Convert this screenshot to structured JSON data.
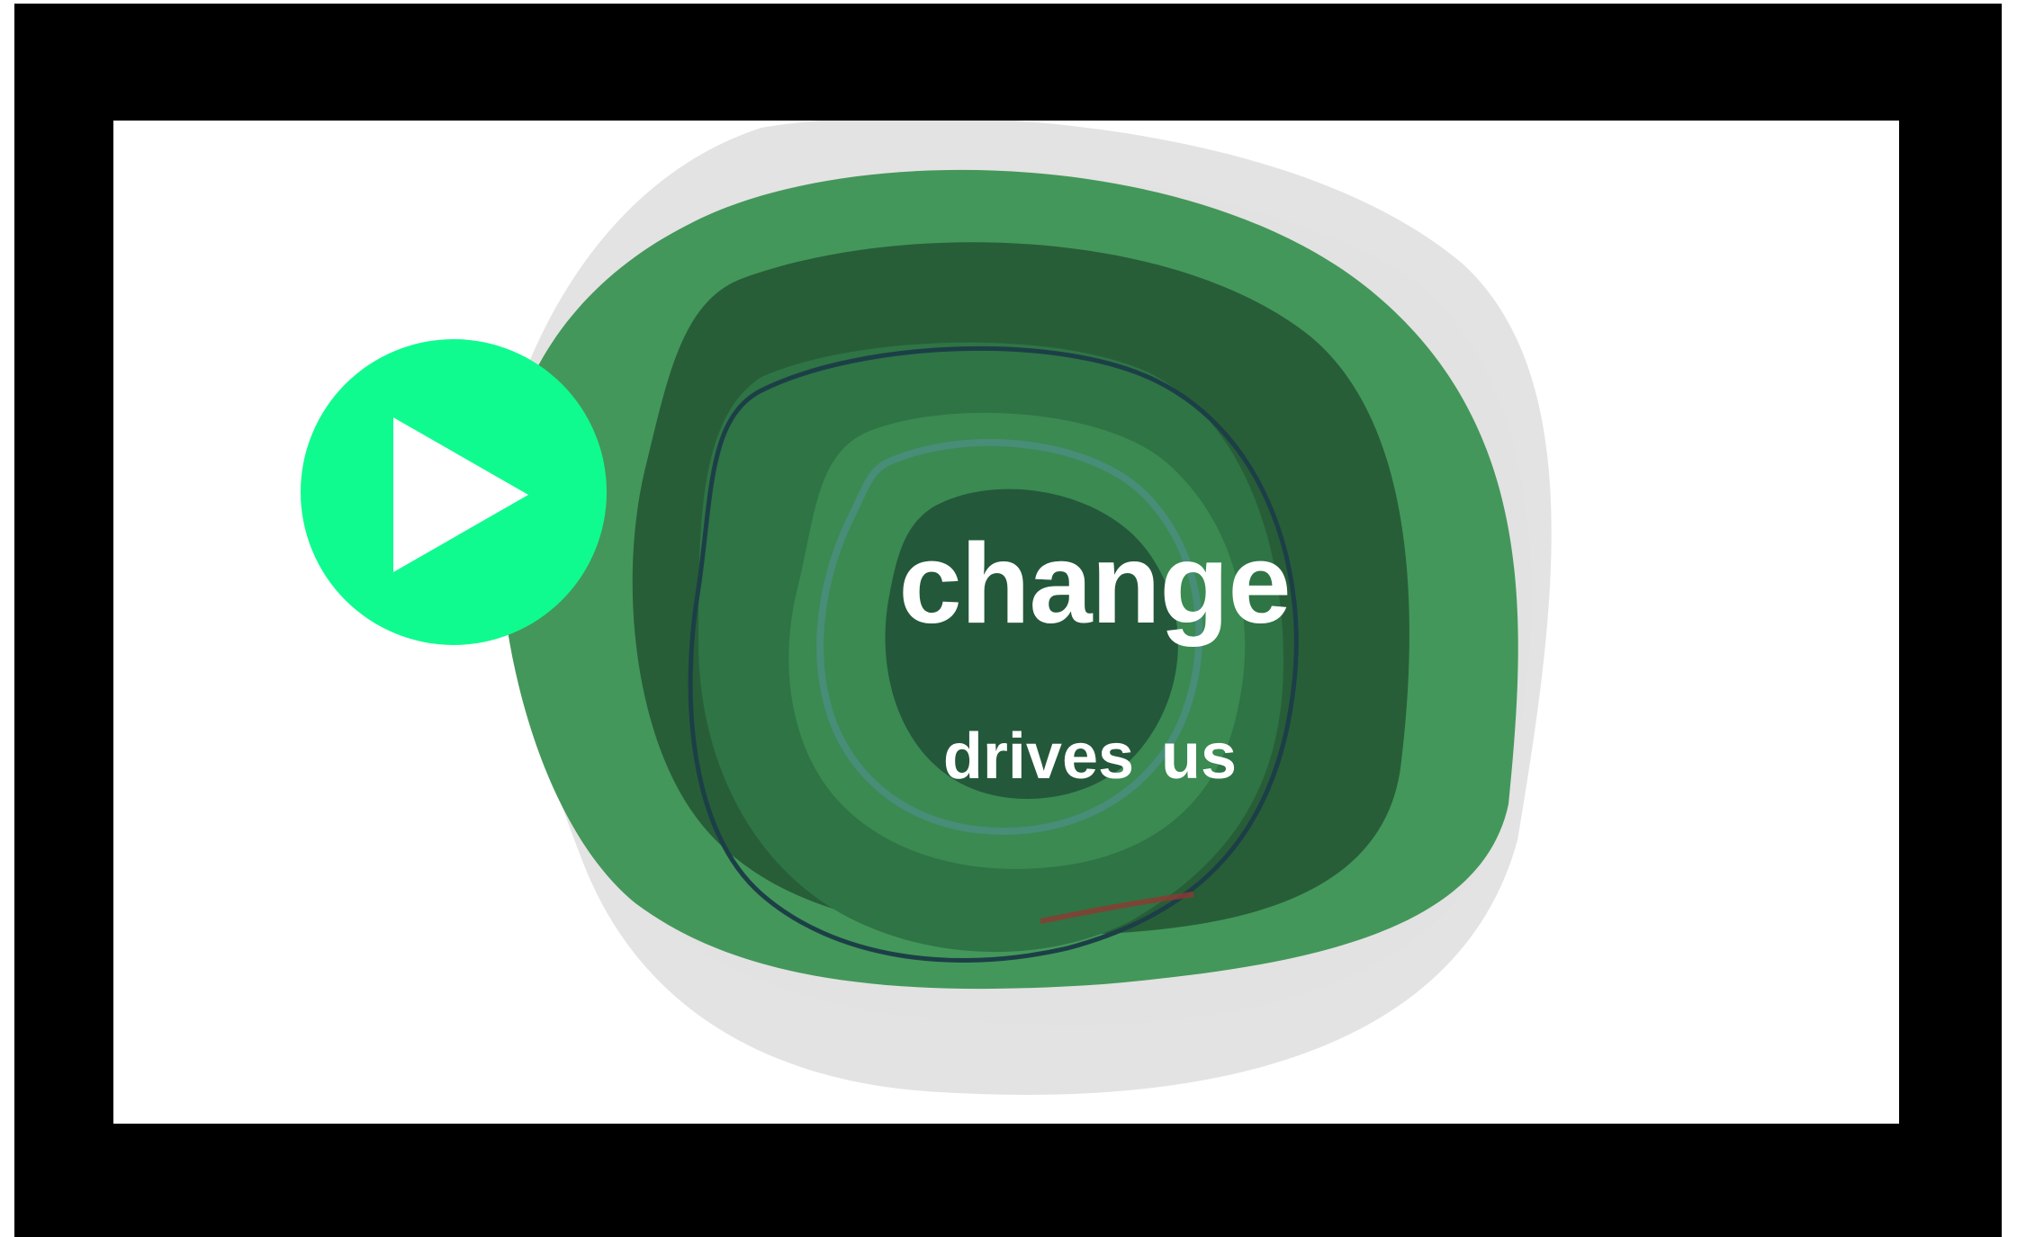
{
  "video": {
    "headline": "change",
    "subline": "drives us"
  },
  "controls": {
    "play_icon": "play-icon",
    "play_color": "#10fb8f"
  },
  "colors": {
    "letterbox": "#000000",
    "background": "#ffffff",
    "ring_light_green": "#44975a",
    "ring_dark_green": "#275e38",
    "ring_mid_green": "#2f7445",
    "shadow_gray": "#d8d8d8"
  }
}
